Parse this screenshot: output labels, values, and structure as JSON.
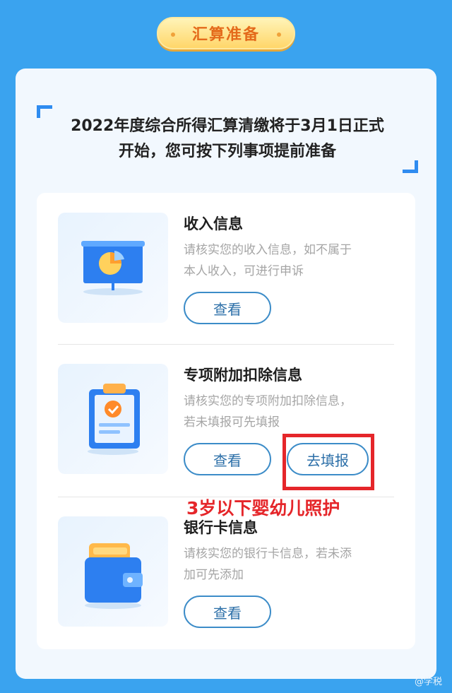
{
  "header": {
    "title": "汇算准备"
  },
  "headline": {
    "line1": "2022年度综合所得汇算清缴将于3月1日正式",
    "line2": "开始，您可按下列事项提前准备"
  },
  "items": [
    {
      "title": "收入信息",
      "desc_line1": "请核实您的收入信息，如不属于",
      "desc_line2": "本人收入，可进行申诉",
      "view_label": "查看"
    },
    {
      "title": "专项附加扣除信息",
      "desc_line1": "请核实您的专项附加扣除信息，",
      "desc_line2": "若未填报可先填报",
      "view_label": "查看",
      "fill_label": "去填报"
    },
    {
      "title": "银行卡信息",
      "desc_line1": "请核实您的银行卡信息，若未添",
      "desc_line2": "加可先添加",
      "view_label": "查看"
    }
  ],
  "annotation": "3岁以下婴幼儿照护",
  "watermark": "@学税",
  "icons": [
    "presentation-chart-icon",
    "clipboard-check-icon",
    "wallet-icon"
  ],
  "colors": {
    "background": "#3aa3ef",
    "accent": "#2f8cf0",
    "annotation": "#e5262a"
  }
}
